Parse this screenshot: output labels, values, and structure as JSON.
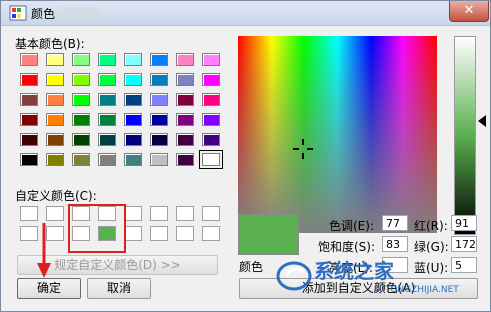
{
  "window": {
    "title": "颜色",
    "close_glyph": "✕"
  },
  "basic": {
    "label": "基本颜色(B):",
    "colors": [
      "#ff8080",
      "#ffff80",
      "#80ff80",
      "#00ff80",
      "#80ffff",
      "#0080ff",
      "#ff80c0",
      "#ff80ff",
      "#ff0000",
      "#ffff00",
      "#80ff00",
      "#00ff40",
      "#00ffff",
      "#0080c0",
      "#8080c0",
      "#ff00ff",
      "#804040",
      "#ff8040",
      "#00ff00",
      "#008080",
      "#004080",
      "#8080ff",
      "#800040",
      "#ff0080",
      "#800000",
      "#ff8000",
      "#008000",
      "#008040",
      "#0000ff",
      "#0000a0",
      "#800080",
      "#8000ff",
      "#400000",
      "#804000",
      "#004000",
      "#004040",
      "#000080",
      "#000040",
      "#400040",
      "#400080",
      "#000000",
      "#808000",
      "#808040",
      "#808080",
      "#408080",
      "#c0c0c0",
      "#400040",
      "#ffffff"
    ]
  },
  "custom": {
    "label": "自定义颜色(C):",
    "colors": [
      "#ffffff",
      "#ffffff",
      "#ffffff",
      "#ffffff",
      "#ffffff",
      "#ffffff",
      "#ffffff",
      "#ffffff",
      "#ffffff",
      "#ffffff",
      "#ffffff",
      "#5ab04e",
      "#ffffff",
      "#ffffff",
      "#ffffff",
      "#ffffff"
    ]
  },
  "define_button": "规定自定义颜色(D) >>",
  "ok_button": "确定",
  "cancel_button": "取消",
  "add_button": "添加到自定义颜色(A)",
  "preview_label": "颜色",
  "fields": {
    "hue_label": "色调(E):",
    "hue_value": "77",
    "sat_label": "饱和度(S):",
    "sat_value": "83",
    "lum_label": "亮度(L):",
    "lum_value": "",
    "red_label": "红(R):",
    "red_value": "91",
    "green_label": "绿(G):",
    "green_value": "172",
    "blue_label": "蓝(U):",
    "blue_value": "5"
  },
  "current_color": "#5ab04e",
  "accent_red": "#e02020",
  "watermark": {
    "brand": "系统之家",
    "url": "XITONGZHIJIA.NET"
  }
}
